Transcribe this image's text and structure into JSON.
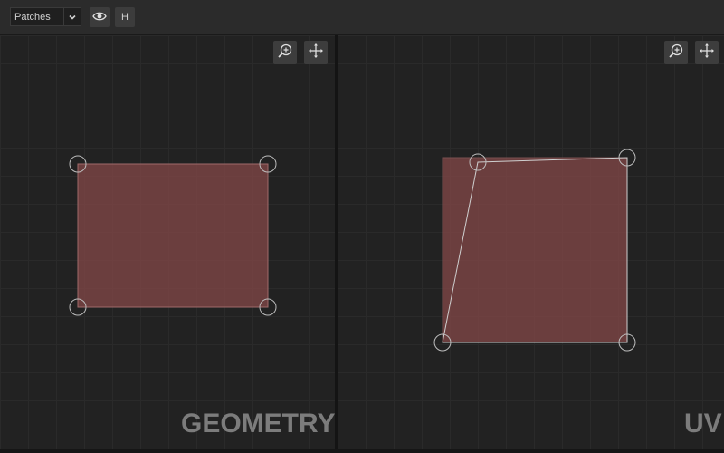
{
  "toolbar": {
    "mode_select": {
      "value": "Patches"
    },
    "visibility_icon": "eye-icon",
    "h_button_label": "H"
  },
  "geometry_view": {
    "label": "GEOMETRY",
    "zoom_icon": "zoom-in-icon",
    "pan_icon": "move-icon"
  },
  "uv_view": {
    "label": "UV",
    "zoom_icon": "zoom-in-icon",
    "pan_icon": "move-icon"
  },
  "colors": {
    "patch_fill": "#8a4a4a",
    "handle_stroke": "#bdbdbd",
    "label_text": "#7c7c7c"
  }
}
